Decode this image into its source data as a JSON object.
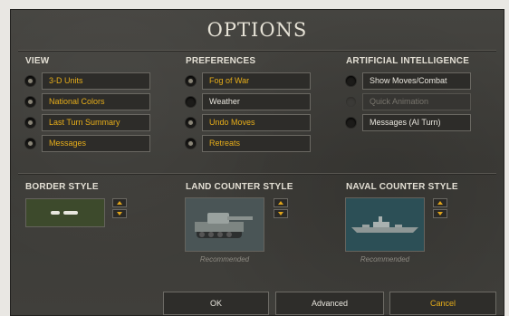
{
  "title": "OPTIONS",
  "view": {
    "heading": "VIEW",
    "options": [
      {
        "label": "3-D Units",
        "checked": true
      },
      {
        "label": "National Colors",
        "checked": true
      },
      {
        "label": "Last Turn Summary",
        "checked": true
      },
      {
        "label": "Messages",
        "checked": true
      }
    ]
  },
  "preferences": {
    "heading": "PREFERENCES",
    "options": [
      {
        "label": "Fog of War",
        "checked": true
      },
      {
        "label": "Weather",
        "checked": false
      },
      {
        "label": "Undo Moves",
        "checked": true
      },
      {
        "label": "Retreats",
        "checked": true
      }
    ]
  },
  "ai": {
    "heading": "ARTIFICIAL INTELLIGENCE",
    "options": [
      {
        "label": "Show Moves/Combat",
        "checked": false
      },
      {
        "label": "Quick Animation",
        "checked": false,
        "disabled": true
      },
      {
        "label": "Messages (AI Turn)",
        "checked": false
      }
    ]
  },
  "border_style": {
    "heading": "BORDER STYLE"
  },
  "land_counter_style": {
    "heading": "LAND COUNTER STYLE",
    "note": "Recommended"
  },
  "naval_counter_style": {
    "heading": "NAVAL COUNTER STYLE",
    "note": "Recommended"
  },
  "buttons": {
    "ok": "OK",
    "advanced": "Advanced",
    "cancel": "Cancel"
  },
  "colors": {
    "accent": "#e6ad1a",
    "panel": "#3f3e3a",
    "border_preview": "#3d4a2c",
    "land_preview": "#4a5556",
    "naval_preview": "#2c4f56"
  }
}
